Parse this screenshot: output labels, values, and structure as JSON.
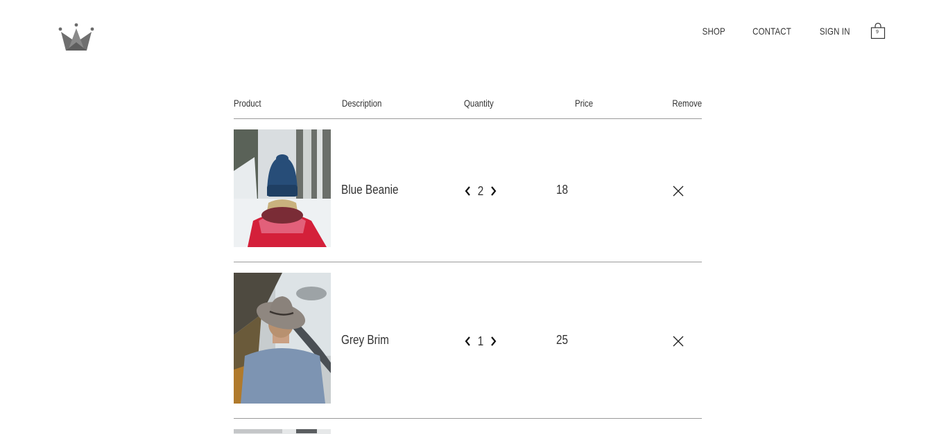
{
  "header": {
    "nav": {
      "shop_label": "SHOP",
      "contact_label": "CONTACT",
      "sign_in_label": "SIGN IN"
    },
    "cart_count": "9"
  },
  "table": {
    "headers": {
      "product": "Product",
      "description": "Description",
      "quantity": "Quantity",
      "price": "Price",
      "remove": "Remove"
    },
    "items": [
      {
        "description": "Blue Beanie",
        "quantity": "2",
        "price": "18"
      },
      {
        "description": "Grey Brim",
        "quantity": "1",
        "price": "25"
      }
    ]
  },
  "icons": {
    "logo": "crown-logo",
    "cart": "shopping-bag-icon",
    "decrement": "chevron-left-icon",
    "increment": "chevron-right-icon",
    "remove": "close-icon"
  }
}
